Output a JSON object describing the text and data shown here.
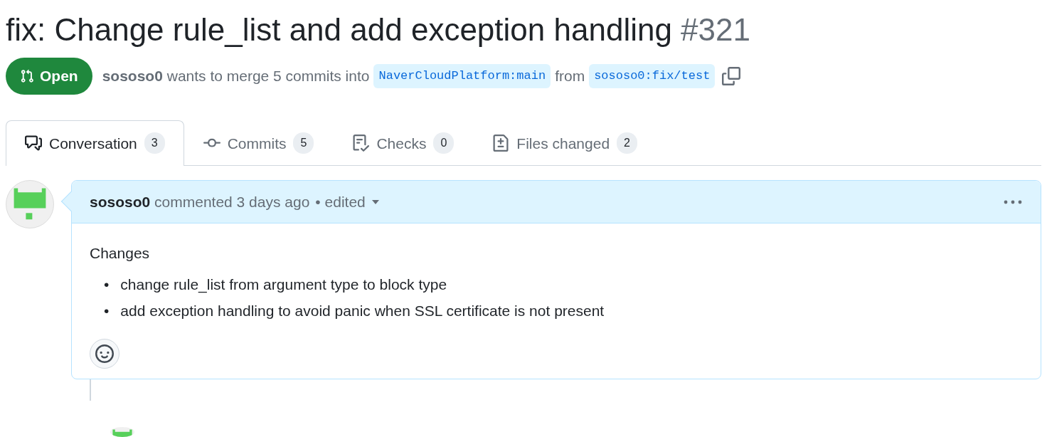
{
  "title": "fix: Change rule_list and add exception handling",
  "number": "#321",
  "state": {
    "label": "Open"
  },
  "meta": {
    "author": "sososo0",
    "text": "wants to merge 5 commits into",
    "base": "NaverCloudPlatform:main",
    "from": "from",
    "head": "sososo0:fix/test"
  },
  "tabs": [
    {
      "label": "Conversation",
      "count": "3",
      "selected": true
    },
    {
      "label": "Commits",
      "count": "5",
      "selected": false
    },
    {
      "label": "Checks",
      "count": "0",
      "selected": false
    },
    {
      "label": "Files changed",
      "count": "2",
      "selected": false
    }
  ],
  "comment": {
    "author": "sososo0",
    "action": "commented 3 days ago",
    "edited": "• edited",
    "heading": "Changes",
    "items": [
      {
        "bullet": "•",
        "text": "change rule_list from argument type to block type"
      },
      {
        "bullet": "•",
        "text": "add exception handling to avoid panic when SSL certificate is not present"
      }
    ]
  }
}
